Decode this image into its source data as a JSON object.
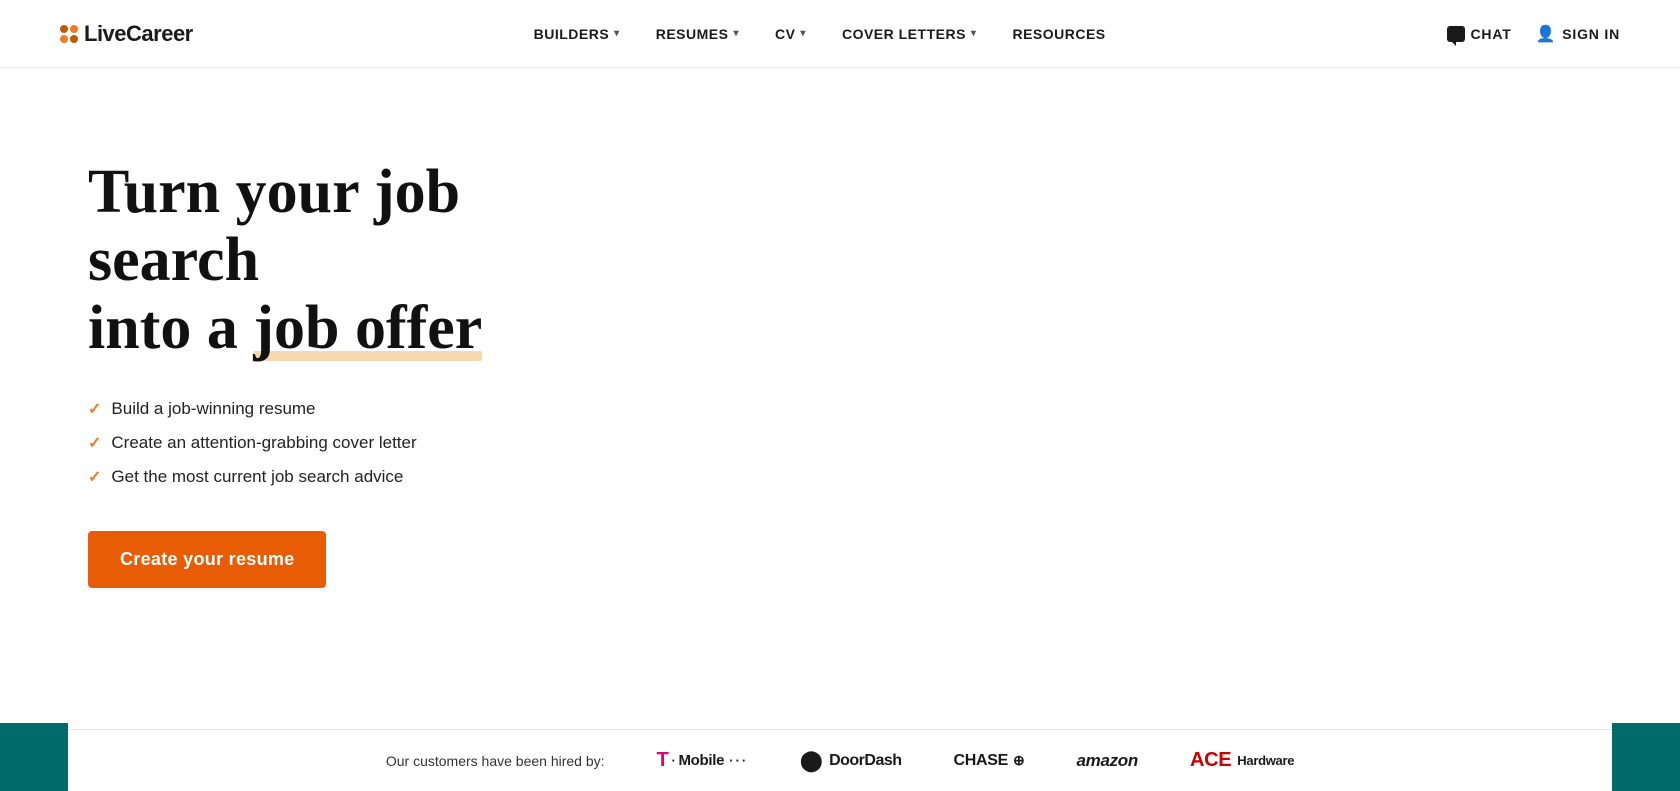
{
  "logo": {
    "text_live": "Live",
    "text_career": "Career",
    "full": "LiveCareer"
  },
  "nav": {
    "items": [
      {
        "label": "BUILDERS",
        "has_dropdown": true
      },
      {
        "label": "RESUMES",
        "has_dropdown": true
      },
      {
        "label": "CV",
        "has_dropdown": true
      },
      {
        "label": "COVER LETTERS",
        "has_dropdown": true
      },
      {
        "label": "RESOURCES",
        "has_dropdown": false
      }
    ],
    "chat_label": "CHAT",
    "signin_label": "SIGN IN"
  },
  "hero": {
    "title_line1": "Turn your job search",
    "title_line2": "into a",
    "title_highlight": "job offer",
    "checklist": [
      "Build a job-winning resume",
      "Create an attention-grabbing cover letter",
      "Get the most current job search advice"
    ],
    "cta_label": "Create your resume"
  },
  "customers": {
    "label": "Our customers have been hired by:",
    "companies": [
      "T·Mobile",
      "DOORDASH",
      "CHASE",
      "amazon",
      "ACE Hardware"
    ]
  }
}
